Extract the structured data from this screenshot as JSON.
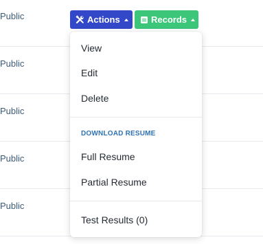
{
  "table": {
    "rows": [
      {
        "visibility": "Public"
      },
      {
        "visibility": "Public"
      },
      {
        "visibility": "Public"
      },
      {
        "visibility": "Public"
      },
      {
        "visibility": "Public"
      }
    ]
  },
  "toolbar": {
    "actions_label": "Actions",
    "records_label": "Records",
    "actions_icon": "tools-icon",
    "records_icon": "records-icon",
    "actions_color": "#3348c8",
    "records_color": "#3cc67a"
  },
  "dropdown": {
    "items": [
      "View",
      "Edit",
      "Delete"
    ],
    "section_header": "DOWNLOAD RESUME",
    "download_items": [
      "Full Resume",
      "Partial Resume"
    ],
    "footer_item": "Test Results (0)"
  }
}
